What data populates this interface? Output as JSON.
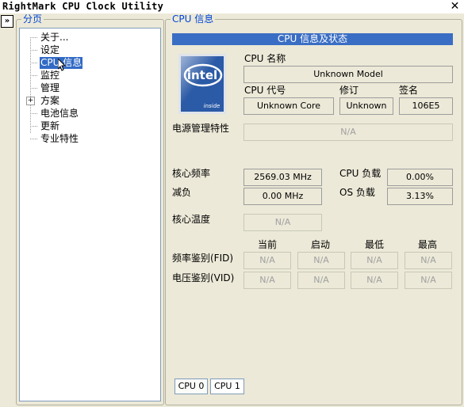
{
  "window": {
    "title": "RightMark CPU Clock Utility",
    "close_glyph": "✕"
  },
  "collapse_glyph": "»",
  "nav": {
    "legend": "分页",
    "items": [
      {
        "label": "关于..."
      },
      {
        "label": "设定"
      },
      {
        "label": "CPU 信息",
        "selected": true
      },
      {
        "label": "监控"
      },
      {
        "label": "管理"
      },
      {
        "label": "方案",
        "expandable": true
      },
      {
        "label": "电池信息"
      },
      {
        "label": "更新"
      },
      {
        "label": "专业特性"
      }
    ],
    "expander_glyph": "+"
  },
  "main": {
    "legend": "CPU 信息",
    "header": "CPU 信息及状态",
    "logo": {
      "brand": "intel",
      "sub": "inside"
    },
    "cpu_name_label": "CPU 名称",
    "cpu_name": "Unknown Model",
    "cpu_code_label": "CPU 代号",
    "cpu_code": "Unknown Core",
    "revision_label": "修订",
    "revision": "Unknown",
    "signature_label": "签名",
    "signature": "106E5",
    "power_label": "电源管理特性",
    "power_value": "N/A",
    "core_freq_label": "核心频率",
    "core_freq": "2569.03 MHz",
    "cpu_load_label": "CPU 负载",
    "cpu_load": "0.00%",
    "throttle_label": "减负",
    "throttle": "0.00 MHz",
    "os_load_label": "OS 负载",
    "os_load": "3.13%",
    "core_temp_label": "核心温度",
    "core_temp": "N/A",
    "columns": [
      "当前",
      "启动",
      "最低",
      "最高"
    ],
    "fid_label": "频率鉴别(FID)",
    "fid_values": [
      "N/A",
      "N/A",
      "N/A",
      "N/A"
    ],
    "vid_label": "电压鉴别(VID)",
    "vid_values": [
      "N/A",
      "N/A",
      "N/A",
      "N/A"
    ],
    "tabs": [
      "CPU 0",
      "CPU 1"
    ],
    "active_tab": "CPU 0"
  }
}
